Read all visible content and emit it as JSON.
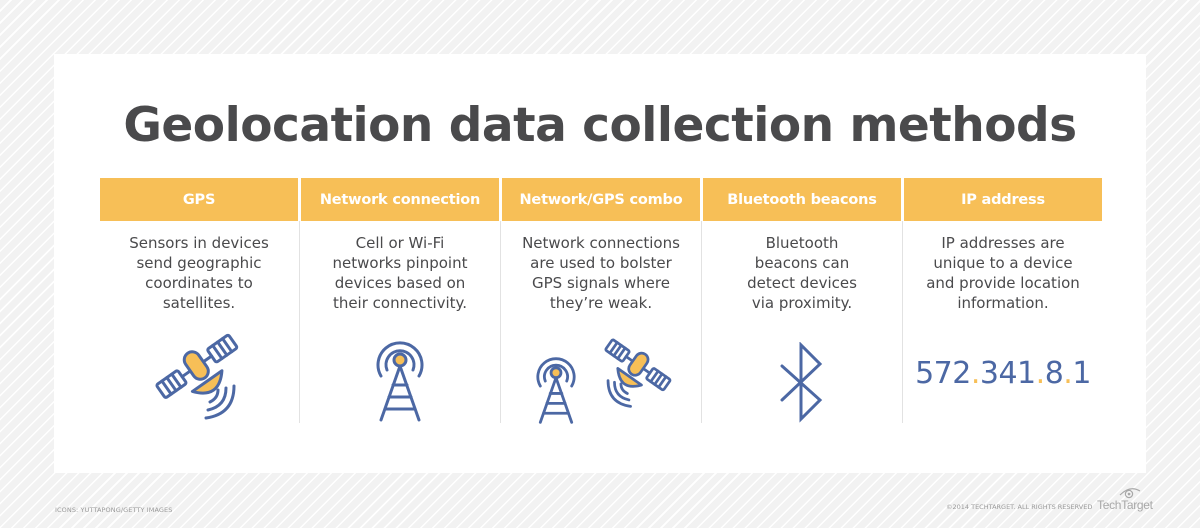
{
  "title": "Geolocation data collection methods",
  "colors": {
    "accent": "#f7bf57",
    "icon_blue": "#4c68a4",
    "text": "#4a4a4c",
    "divider": "#e2e2e2"
  },
  "columns": [
    {
      "header": "GPS",
      "desc": [
        "Sensors in devices",
        "send geographic",
        "coordinates to",
        "satellites."
      ],
      "icon": "satellite-icon"
    },
    {
      "header": "Network connection",
      "desc": [
        "Cell or Wi-Fi",
        "networks pinpoint",
        "devices based on",
        "their connectivity."
      ],
      "icon": "cell-tower-icon"
    },
    {
      "header": "Network/GPS combo",
      "desc": [
        "Network connections",
        "are used to bolster",
        "GPS signals where",
        "they’re weak."
      ],
      "icon": "cell-tower-and-satellite-icon"
    },
    {
      "header": "Bluetooth beacons",
      "desc": [
        "Bluetooth",
        "beacons can",
        "detect devices",
        "via proximity."
      ],
      "icon": "bluetooth-icon"
    },
    {
      "header": "IP address",
      "desc": [
        "IP addresses are",
        "unique to a device",
        "and provide location",
        "information."
      ],
      "icon": "ip-address-text",
      "ip_parts": [
        "572",
        ".",
        "341",
        ".",
        "8",
        ".",
        "1"
      ]
    }
  ],
  "footer": {
    "credit_left": "ICONS: YUTTAPONG/GETTY IMAGES",
    "credit_right": "©2014 TECHTARGET. ALL RIGHTS RESERVED",
    "brand": "TechTarget"
  }
}
